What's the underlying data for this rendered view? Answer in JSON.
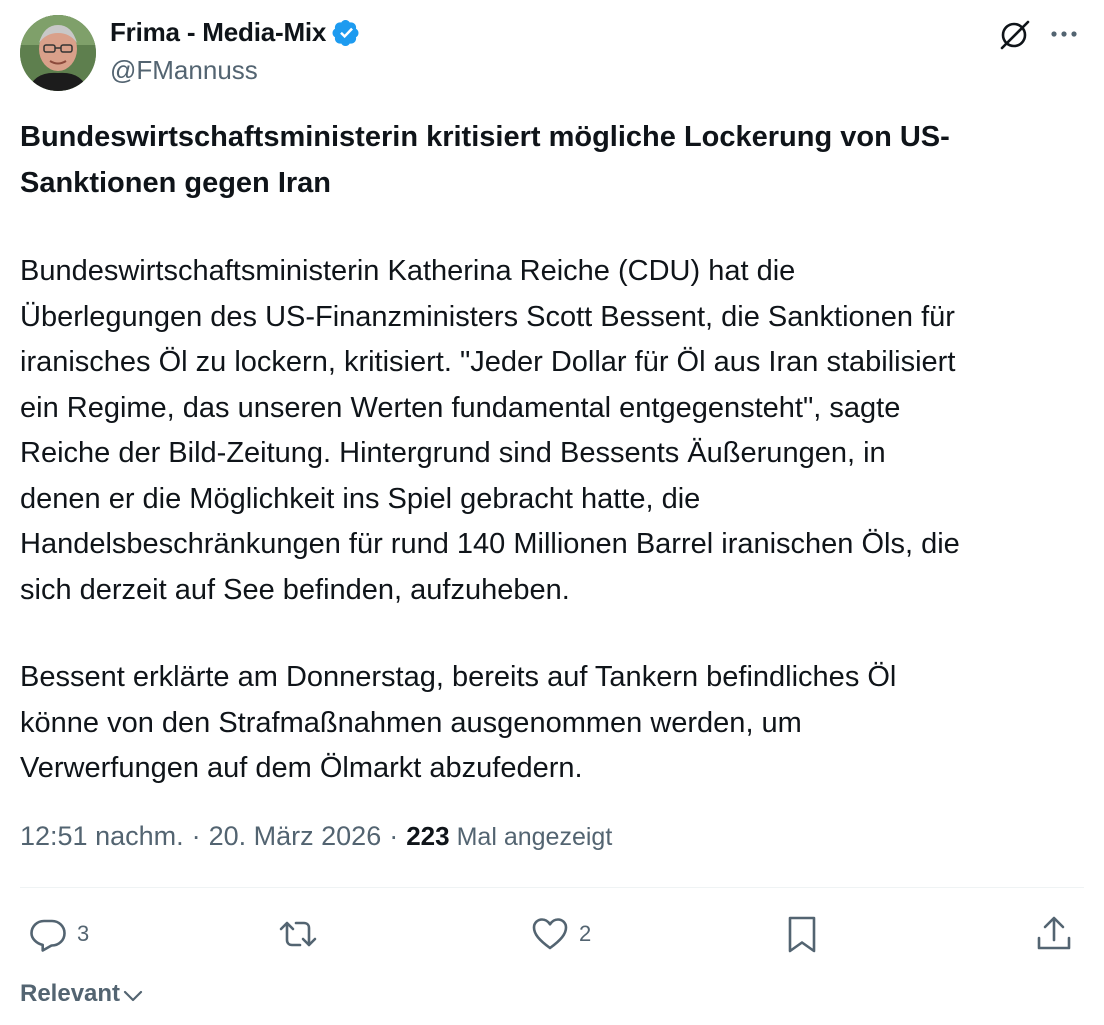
{
  "author": {
    "name": "Frima - Media-Mix",
    "handle": "@FMannuss",
    "verified": true
  },
  "icons": {
    "verified": "verified-badge-icon",
    "grok": "grok-icon",
    "more": "more-options-icon",
    "reply": "reply-icon",
    "retweet": "retweet-icon",
    "like": "like-icon",
    "bookmark": "bookmark-icon",
    "share": "share-icon",
    "sort": "chevron-down-icon"
  },
  "colors": {
    "text": "#0f1419",
    "secondary": "#536471",
    "verified": "#1d9bf0",
    "divider": "#eff3f4"
  },
  "post": {
    "headline": "Bundeswirtschaftsministerin kritisiert mögliche Lockerung von US-\nSanktionen gegen Iran",
    "paragraphs": [
      "Bundeswirtschaftsministerin Katherina Reiche (CDU) hat die\nÜberlegungen des US-Finanzministers Scott Bessent, die Sanktionen für\niranisches Öl zu lockern, kritisiert. \"Jeder Dollar für Öl aus Iran stabilisiert\nein Regime, das unseren Werten fundamental entgegensteht\", sagte\nReiche der Bild-Zeitung. Hintergrund sind Bessents Äußerungen, in\ndenen er die Möglichkeit ins Spiel gebracht hatte, die\nHandelsbeschränkungen für rund 140 Millionen Barrel iranischen Öls, die\nsich derzeit auf See befinden, aufzuheben.",
      "Bessent erklärte am Donnerstag, bereits auf Tankern befindliches Öl\nkönne von den Strafmaßnahmen ausgenommen werden, um\nVerwerfungen auf dem Ölmarkt abzufedern."
    ]
  },
  "meta": {
    "time": "12:51 nachm.",
    "separator": "·",
    "date": "20. März 2026",
    "views_count": "223",
    "views_label": "Mal angezeigt"
  },
  "actions": {
    "reply_count": "3",
    "retweet_count": "",
    "like_count": "2"
  },
  "sort": {
    "label": "Relevant"
  }
}
